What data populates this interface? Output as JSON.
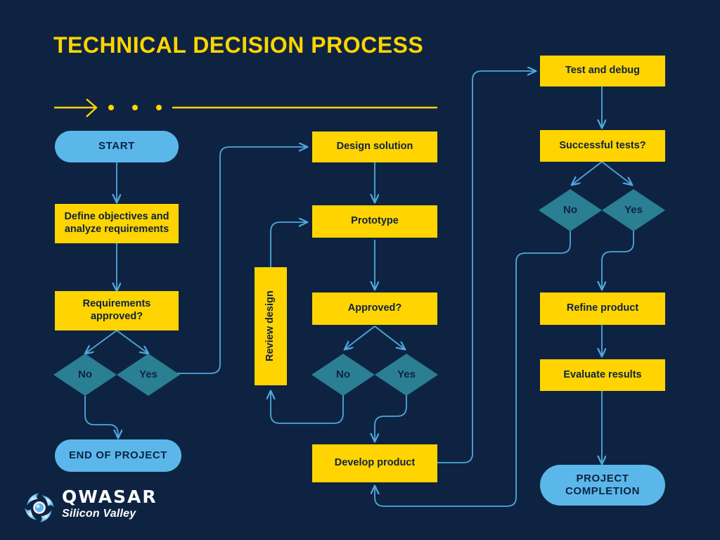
{
  "header": {
    "title": "TECHNICAL DECISION PROCESS",
    "divider_icon": "arrow-right-dots-rule"
  },
  "colors": {
    "background": "#0e2342",
    "process_fill": "#FFD400",
    "terminator_fill": "#5BB7EA",
    "decision_fill": "#2B7F93",
    "connector": "#4FA8DC",
    "title": "#FFD400",
    "node_text": "#0e2342"
  },
  "chart_data": {
    "type": "flowchart",
    "title": "TECHNICAL DECISION PROCESS",
    "nodes": [
      {
        "id": "start",
        "label": "START",
        "shape": "terminator",
        "column": "left"
      },
      {
        "id": "define",
        "label": "Define objectives and analyze requirements",
        "shape": "process",
        "column": "left"
      },
      {
        "id": "req_approved",
        "label": "Requirements approved?",
        "shape": "process",
        "column": "left"
      },
      {
        "id": "req_no",
        "label": "No",
        "shape": "decision",
        "column": "left"
      },
      {
        "id": "req_yes",
        "label": "Yes",
        "shape": "decision",
        "column": "left"
      },
      {
        "id": "end_project",
        "label": "END OF PROJECT",
        "shape": "terminator",
        "column": "left"
      },
      {
        "id": "design",
        "label": "Design solution",
        "shape": "process",
        "column": "middle"
      },
      {
        "id": "prototype",
        "label": "Prototype",
        "shape": "process",
        "column": "middle"
      },
      {
        "id": "approved",
        "label": "Approved?",
        "shape": "process",
        "column": "middle"
      },
      {
        "id": "review",
        "label": "Review design",
        "shape": "process",
        "column": "middle",
        "orientation": "vertical"
      },
      {
        "id": "app_no",
        "label": "No",
        "shape": "decision",
        "column": "middle"
      },
      {
        "id": "app_yes",
        "label": "Yes",
        "shape": "decision",
        "column": "middle"
      },
      {
        "id": "develop",
        "label": "Develop product",
        "shape": "process",
        "column": "middle"
      },
      {
        "id": "test",
        "label": "Test and debug",
        "shape": "process",
        "column": "right"
      },
      {
        "id": "success",
        "label": "Successful tests?",
        "shape": "process",
        "column": "right"
      },
      {
        "id": "suc_no",
        "label": "No",
        "shape": "decision",
        "column": "right"
      },
      {
        "id": "suc_yes",
        "label": "Yes",
        "shape": "decision",
        "column": "right"
      },
      {
        "id": "refine",
        "label": "Refine product",
        "shape": "process",
        "column": "right"
      },
      {
        "id": "evaluate",
        "label": "Evaluate results",
        "shape": "process",
        "column": "right"
      },
      {
        "id": "completion",
        "label": "PROJECT COMPLETION",
        "shape": "terminator",
        "column": "right"
      }
    ],
    "edges": [
      {
        "from": "start",
        "to": "define"
      },
      {
        "from": "define",
        "to": "req_approved"
      },
      {
        "from": "req_approved",
        "to": "req_no"
      },
      {
        "from": "req_approved",
        "to": "req_yes"
      },
      {
        "from": "req_no",
        "to": "end_project"
      },
      {
        "from": "req_yes",
        "to": "design"
      },
      {
        "from": "design",
        "to": "prototype"
      },
      {
        "from": "prototype",
        "to": "approved"
      },
      {
        "from": "approved",
        "to": "app_no"
      },
      {
        "from": "approved",
        "to": "app_yes"
      },
      {
        "from": "app_no",
        "to": "review"
      },
      {
        "from": "review",
        "to": "prototype"
      },
      {
        "from": "app_yes",
        "to": "develop"
      },
      {
        "from": "develop",
        "to": "test"
      },
      {
        "from": "test",
        "to": "success"
      },
      {
        "from": "success",
        "to": "suc_no"
      },
      {
        "from": "success",
        "to": "suc_yes"
      },
      {
        "from": "suc_no",
        "to": "develop"
      },
      {
        "from": "suc_yes",
        "to": "refine"
      },
      {
        "from": "refine",
        "to": "evaluate"
      },
      {
        "from": "evaluate",
        "to": "completion"
      }
    ]
  },
  "nodes": {
    "start": "START",
    "define": "Define objectives and analyze requirements",
    "req_approved": "Requirements approved?",
    "req_no": "No",
    "req_yes": "Yes",
    "end_project": "END OF PROJECT",
    "design": "Design solution",
    "prototype": "Prototype",
    "approved": "Approved?",
    "review": "Review design",
    "app_no": "No",
    "app_yes": "Yes",
    "develop": "Develop product",
    "test": "Test and debug",
    "success": "Successful tests?",
    "suc_no": "No",
    "suc_yes": "Yes",
    "refine": "Refine product",
    "evaluate": "Evaluate results",
    "completion": "PROJECT COMPLETION"
  },
  "logo": {
    "name": "QWASAR",
    "tagline": "Silicon Valley",
    "mark_icon": "spiral-vortex-icon"
  }
}
